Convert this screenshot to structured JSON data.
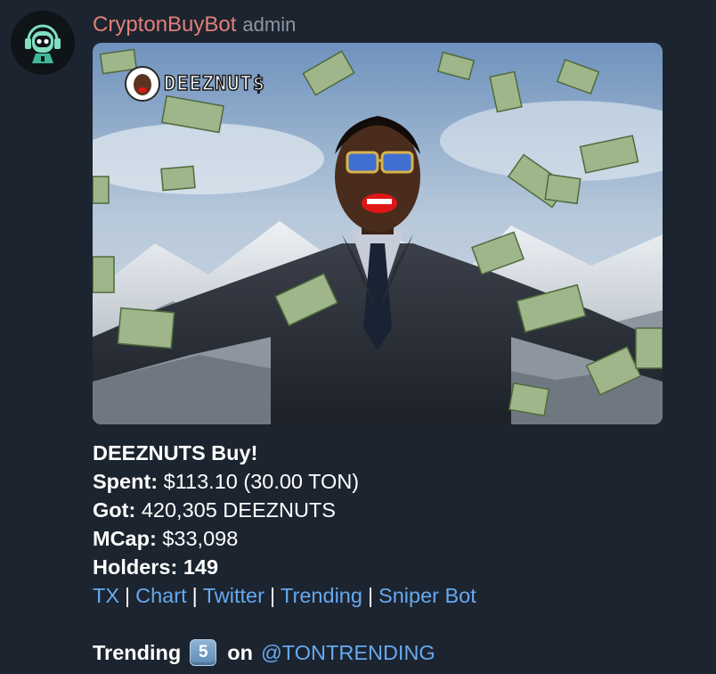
{
  "message": {
    "sender": "CryptonBuyBot",
    "role": "admin",
    "avatar_icon": "robot-headset-icon",
    "media": {
      "token_tag": "DEEZNUT$",
      "description_icon": "money-rain-image"
    },
    "lines": {
      "title": "DEEZNUTS Buy!",
      "spent_label": "Spent:",
      "spent_value": "$113.10 (30.00 TON)",
      "got_label": "Got:",
      "got_value": "420,305 DEEZNUTS",
      "mcap_label": "MCap:",
      "mcap_value": "$33,098",
      "holders_label": "Holders:",
      "holders_value": "149"
    },
    "links": {
      "tx": "TX",
      "chart": "Chart",
      "twitter": "Twitter",
      "trending": "Trending",
      "sniper": "Sniper Bot",
      "separator": "|"
    },
    "trending_footer": {
      "label": "Trending",
      "rank": "5",
      "on": "on",
      "channel": "@TONTRENDING"
    }
  },
  "colors": {
    "background": "#1c2430",
    "sender": "#e27f78",
    "role": "#8d97a3",
    "link": "#66a9ee",
    "text": "#ffffff"
  }
}
